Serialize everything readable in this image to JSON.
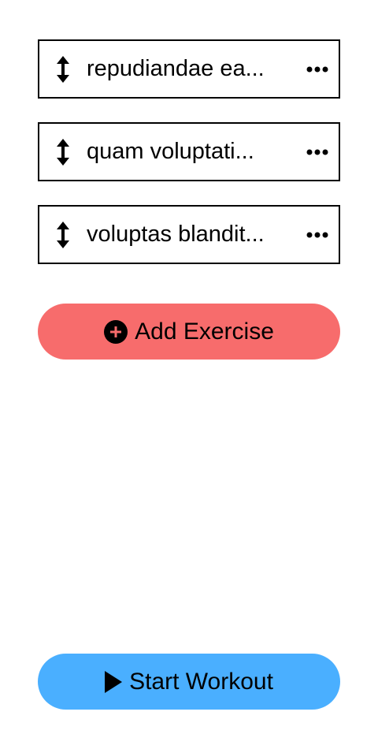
{
  "exercises": [
    {
      "name": "repudiandae ea..."
    },
    {
      "name": "quam voluptati..."
    },
    {
      "name": "voluptas blandit..."
    }
  ],
  "add_exercise": {
    "label": "Add Exercise",
    "icon": "plus-circle-icon",
    "color": "#F76C6C"
  },
  "start_workout": {
    "label": "Start Workout",
    "icon": "play-icon",
    "color": "#4AAFFF"
  },
  "icons": {
    "drag": "arrows-vertical-icon",
    "more": "ellipsis-icon"
  }
}
